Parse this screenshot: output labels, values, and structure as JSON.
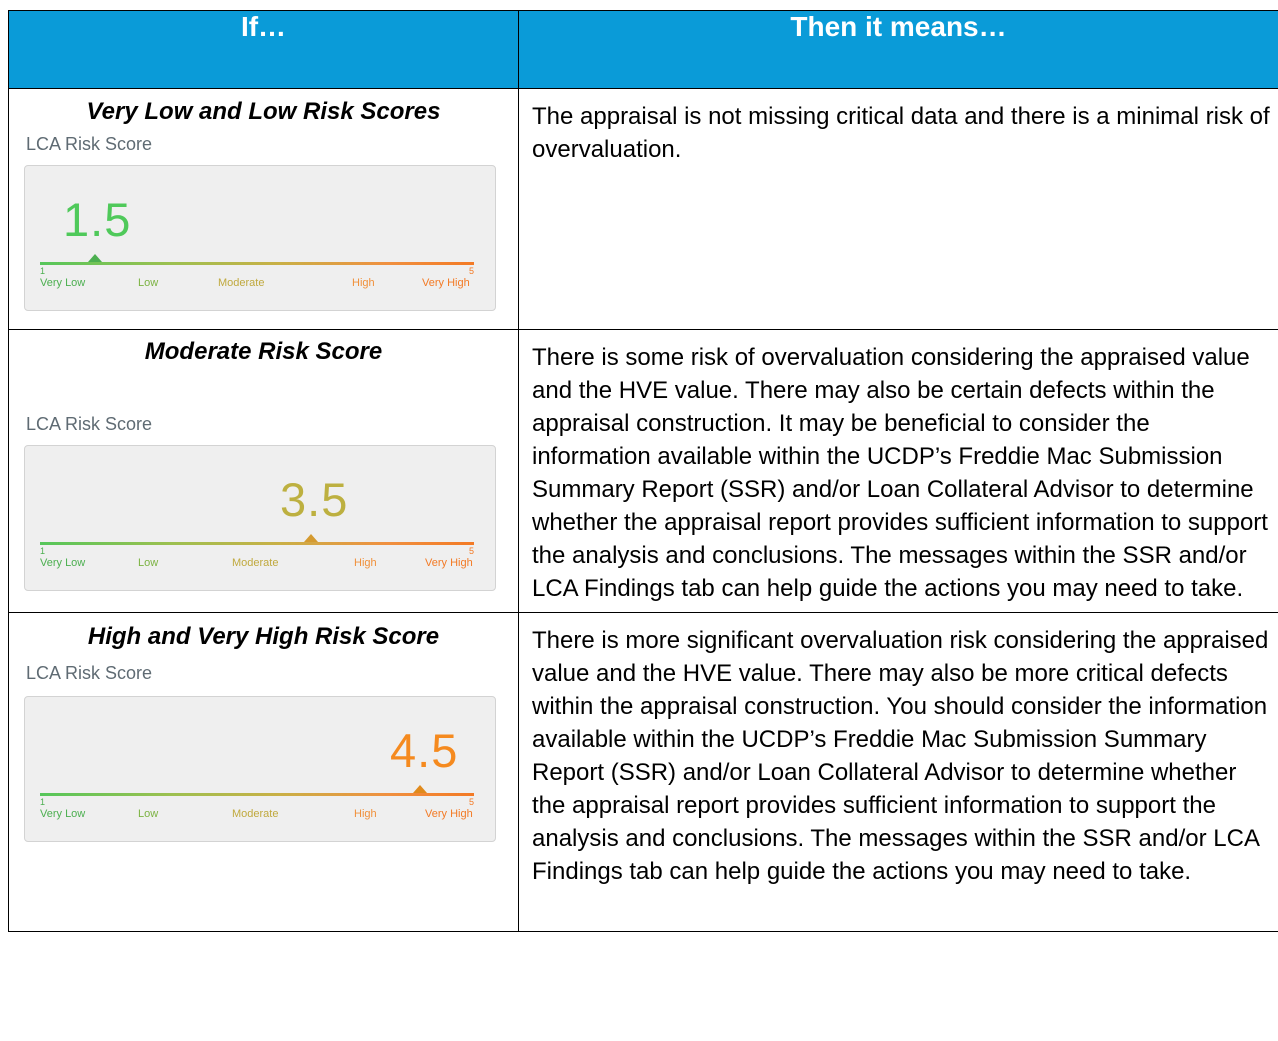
{
  "header": {
    "col1": "If…",
    "col2": "Then it means…"
  },
  "scale": {
    "min": "1",
    "max": "5",
    "levels": [
      "Very Low",
      "Low",
      "Moderate",
      "High",
      "Very High"
    ],
    "colors": {
      "very_low": "#4caf50",
      "low": "#8bc34a",
      "moderate": "#c0a93e",
      "high": "#f0903a",
      "very_high": "#f37a25"
    }
  },
  "rows": [
    {
      "title": "Very Low and Low Risk Scores",
      "card_label": "LCA Risk Score",
      "score": "1.5",
      "score_color": "#4fc95a",
      "description": "The appraisal is not missing critical data and there is a minimal risk of overvaluation."
    },
    {
      "title": "Moderate Risk Score",
      "card_label": "LCA Risk Score",
      "score": "3.5",
      "score_color": "#bdb040",
      "description": "There is some risk of overvaluation considering the appraised value and the HVE value. There may also be certain defects within the appraisal construction. It may be beneficial to consider the information available within the UCDP’s Freddie Mac Submission Summary Report (SSR) and/or Loan Collateral Advisor to determine whether the appraisal report provides sufficient information to support the analysis and conclusions. The messages within the SSR and/or LCA Findings tab can help guide the actions you may need to take."
    },
    {
      "title": "High and Very High Risk Score",
      "card_label": "LCA Risk Score",
      "score": "4.5",
      "score_color": "#f58a1f",
      "description": "There is more significant overvaluation risk considering the appraised value and the HVE value. There may also be more critical defects within the appraisal construction. You should consider the information available within the UCDP’s Freddie Mac Submission Summary Report (SSR) and/or Loan Collateral Advisor to determine whether the appraisal report provides sufficient information to support the analysis and conclusions. The messages within the SSR and/or LCA Findings tab can help guide the actions you may need to take."
    }
  ]
}
